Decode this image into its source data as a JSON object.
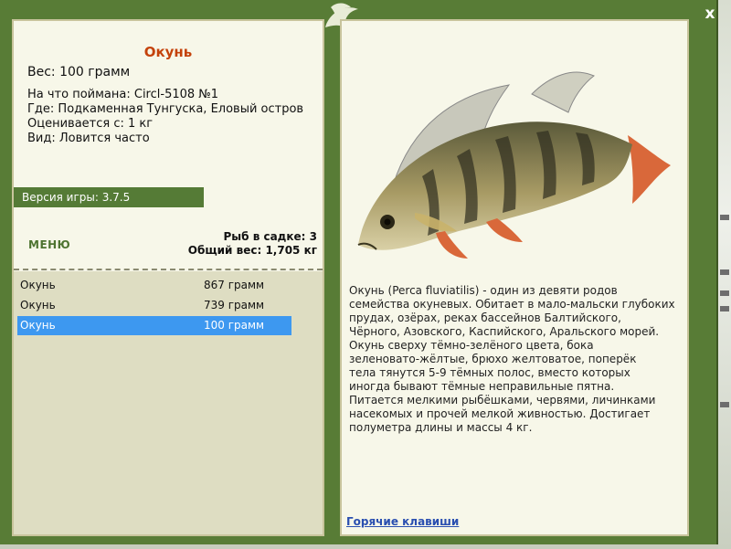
{
  "window": {
    "close_label": "x"
  },
  "fish": {
    "title": "Окунь",
    "weight": "Вес: 100 грамм",
    "caught_with": "На что поймана: Circl-5108 №1",
    "where": "Где: Подкаменная Тунгуска, Еловый остров",
    "rated_from": "Оценивается с: 1 кг",
    "kind": "Вид: Ловится часто"
  },
  "version": "Версия игры: 3.7.5",
  "menu_label": "МЕНЮ",
  "keepnet": {
    "count": "Рыб в садке: 3",
    "total": "Общий вес: 1,705 кг"
  },
  "catch_list": [
    {
      "name": "Окунь",
      "weight": "867 грамм",
      "selected": false
    },
    {
      "name": "Окунь",
      "weight": "739 грамм",
      "selected": false
    },
    {
      "name": "Окунь",
      "weight": "100 грамм",
      "selected": true
    }
  ],
  "description_lines": [
    "Окунь (Perca fluviatilis) - один из девяти родов",
    "семейства окуневых. Обитает в мало-мальски глубоких",
    "прудах, озёрах, реках бассейнов Балтийского,",
    "Чёрного, Азовского, Каспийского, Аральского морей.",
    "Окунь сверху тёмно-зелёного цвета, бока",
    "зеленовато-жёлтые, брюхо желтоватое, поперёк",
    "тела тянутся 5-9 тёмных полос, вместо которых",
    "иногда бывают тёмные неправильные пятна.",
    "Питается мелкими рыбёшками, червями, личинками",
    "насекомых и прочей мелкой живностью. Достигает",
    "полуметра длины и массы 4 кг."
  ],
  "hotkeys_label": "Горячие клавиши",
  "colors": {
    "frame": "#587c36",
    "panel": "#f7f7e9",
    "title": "#c4420b",
    "selected": "#3d98f0",
    "link": "#2a4fb0"
  }
}
